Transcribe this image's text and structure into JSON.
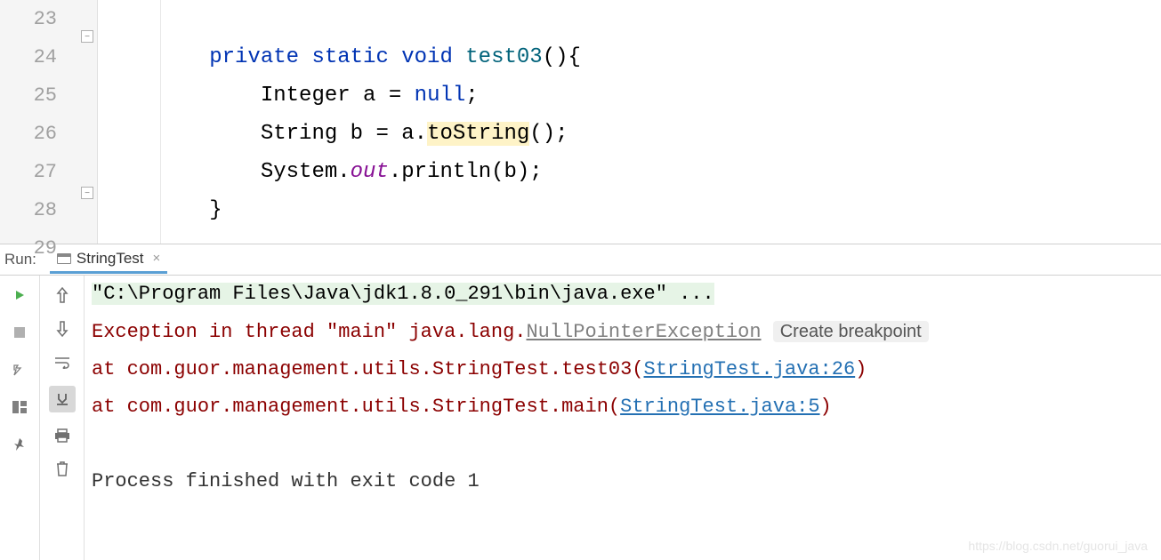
{
  "editor": {
    "lines": [
      {
        "num": "23",
        "code": ""
      },
      {
        "num": "24",
        "code": "        private static void test03(){"
      },
      {
        "num": "25",
        "code": "            Integer a = null;"
      },
      {
        "num": "26",
        "code": "            String b = a.toString();"
      },
      {
        "num": "27",
        "code": "            System.out.println(b);"
      },
      {
        "num": "28",
        "code": "        }"
      },
      {
        "num": "29",
        "code": ""
      }
    ],
    "highlight_token": "toString"
  },
  "run": {
    "label": "Run:",
    "tab_name": "StringTest",
    "command": "\"C:\\Program Files\\Java\\jdk1.8.0_291\\bin\\java.exe\" ...",
    "exception_prefix": "Exception in thread \"main\" java.lang.",
    "exception_class": "NullPointerException",
    "create_breakpoint": "Create breakpoint",
    "stack": [
      {
        "prefix": "\tat com.guor.management.utils.StringTest.test03(",
        "link": "StringTest.java:26",
        "suffix": ")"
      },
      {
        "prefix": "\tat com.guor.management.utils.StringTest.main(",
        "link": "StringTest.java:5",
        "suffix": ")"
      }
    ],
    "exit": "Process finished with exit code 1"
  },
  "watermark": "https://blog.csdn.net/guorui_java"
}
